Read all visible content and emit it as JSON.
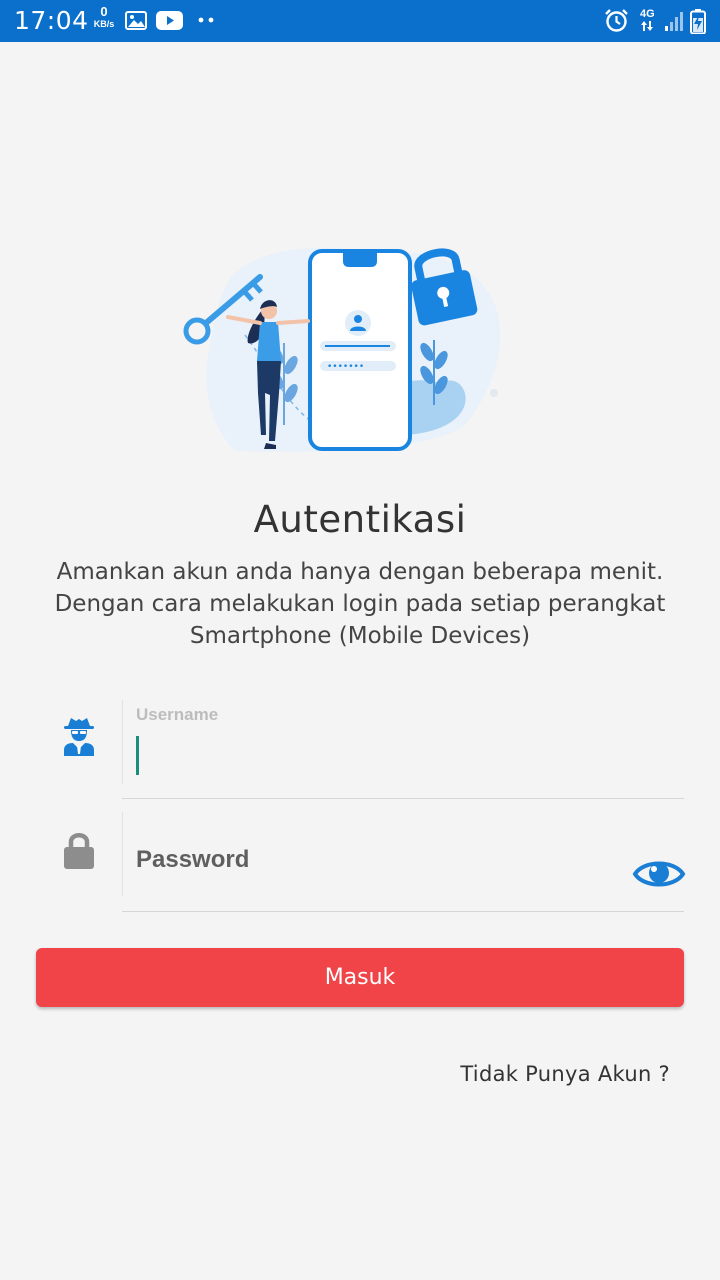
{
  "status_bar": {
    "time": "17:04",
    "net_speed_value": "0",
    "net_speed_unit": "KB/s",
    "network": "4G",
    "icons": [
      "image-icon",
      "youtube-icon",
      "more-dots-icon",
      "alarm-icon",
      "data-arrows-icon",
      "signal-icon",
      "battery-charging-icon"
    ],
    "background": "#0b6fcc"
  },
  "illustration": {
    "name": "phone-login-illustration",
    "icons": [
      "key-icon",
      "padlock-icon",
      "smartphone-icon",
      "person-icon"
    ]
  },
  "auth": {
    "title": "Autentikasi",
    "subtitle_line1": "Amankan akun anda hanya dengan beberapa menit.",
    "subtitle_line2": "Dengan cara melakukan login pada setiap perangkat",
    "subtitle_line3": "Smartphone (Mobile Devices)"
  },
  "form": {
    "username_label": "Username",
    "username_value": "",
    "username_icon": "user-secret-icon",
    "password_placeholder": "Password",
    "password_icon": "lock-icon",
    "toggle_icon": "eye-icon",
    "submit_label": "Masuk",
    "register_link": "Tidak Punya Akun ?"
  },
  "colors": {
    "accent_blue": "#1a7fd4",
    "button_red": "#f04448",
    "caret_teal": "#1a8d7c",
    "background": "#f4f4f4"
  }
}
